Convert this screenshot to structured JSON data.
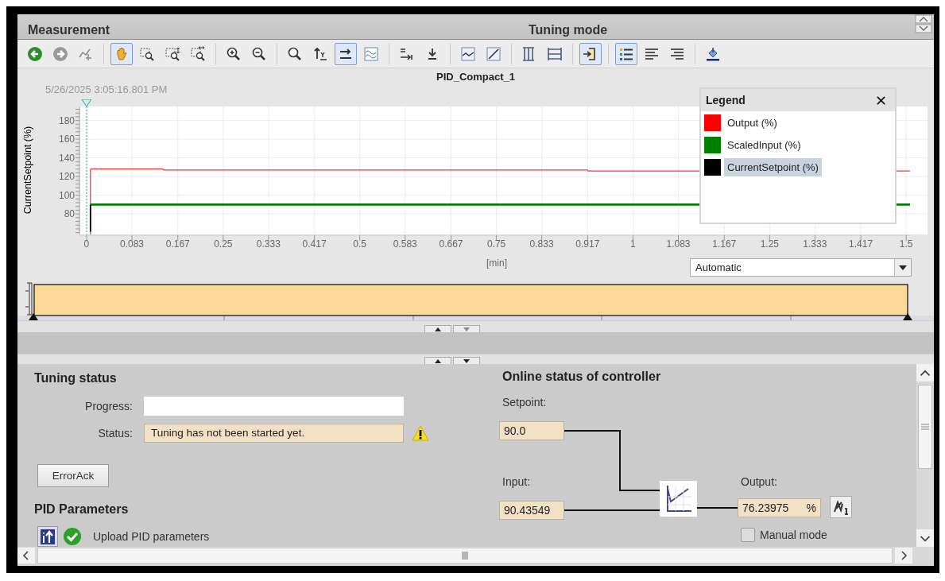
{
  "header": {
    "left": "Measurement",
    "right": "Tuning mode"
  },
  "toolbar_groups": [
    {
      "buttons": [
        {
          "kind": "back",
          "selected": false
        },
        {
          "kind": "forward",
          "selected": false
        },
        {
          "kind": "graph",
          "selected": false
        }
      ]
    },
    {
      "buttons": [
        {
          "kind": "hand",
          "selected": true
        },
        {
          "kind": "zoombox",
          "selected": false
        },
        {
          "kind": "zoomv",
          "selected": false
        },
        {
          "kind": "zoomh",
          "selected": false
        }
      ]
    },
    {
      "buttons": [
        {
          "kind": "zoomin",
          "selected": false
        },
        {
          "kind": "zoomout",
          "selected": false
        }
      ]
    },
    {
      "buttons": [
        {
          "kind": "zoomreset",
          "selected": false
        },
        {
          "kind": "yreset",
          "selected": false
        },
        {
          "kind": "xreset",
          "selected": true
        },
        {
          "kind": "wave",
          "selected": false
        }
      ]
    },
    {
      "buttons": [
        {
          "kind": "time",
          "selected": false
        },
        {
          "kind": "down",
          "selected": false
        }
      ]
    },
    {
      "buttons": [
        {
          "kind": "stepline",
          "selected": false
        },
        {
          "kind": "diagonal",
          "selected": false
        }
      ]
    },
    {
      "buttons": [
        {
          "kind": "columns",
          "selected": false
        },
        {
          "kind": "rows",
          "selected": false
        }
      ]
    },
    {
      "buttons": [
        {
          "kind": "measure",
          "selected": true
        }
      ]
    },
    {
      "buttons": [
        {
          "kind": "list",
          "selected": true
        },
        {
          "kind": "alignleft",
          "selected": false
        },
        {
          "kind": "alignright",
          "selected": false
        }
      ]
    },
    {
      "buttons": [
        {
          "kind": "paint",
          "selected": false
        }
      ]
    }
  ],
  "cursor_time": "5/26/2025  3:05:16.801 PM",
  "chart_data": {
    "type": "line",
    "title": "PID_Compact_1",
    "xlabel": "[min]",
    "ylabel": "CurrentSetpoint (%)",
    "x": [
      0.007,
      0.007,
      0.14,
      0.14,
      0.917,
      0.917,
      1.507
    ],
    "series": [
      {
        "name": "Output (%)",
        "color": "#ff0000",
        "values": [
          58,
          128,
          128,
          127,
          127,
          126,
          126
        ]
      },
      {
        "name": "ScaledInput (%)",
        "color": "#008000",
        "values": [
          null,
          90,
          90,
          90,
          90,
          90,
          90
        ]
      },
      {
        "name": "CurrentSetpoint (%)",
        "color": "#000000",
        "values": [
          61,
          90,
          null,
          null,
          null,
          null,
          null
        ]
      }
    ],
    "ref_lines": [
      {
        "axis": "x",
        "value": 0
      }
    ],
    "grid": true,
    "xlim": [
      -0.013,
      1.507
    ],
    "ylim": [
      58,
      195
    ],
    "xticks": [
      0,
      0.083,
      0.167,
      0.25,
      0.333,
      0.417,
      0.5,
      0.583,
      0.667,
      0.75,
      0.833,
      0.917,
      1,
      1.083,
      1.167,
      1.25,
      1.333,
      1.417,
      1.5
    ],
    "yticks": [
      80,
      100,
      120,
      140,
      160,
      180
    ]
  },
  "legend": {
    "title": "Legend",
    "close": "✕",
    "rows": [
      {
        "selected": false
      },
      {
        "selected": false
      },
      {
        "selected": true
      }
    ]
  },
  "time_range": {
    "value": "Automatic"
  },
  "tuning_status": {
    "title": "Tuning status",
    "progress": {
      "label": "Progress:",
      "level": 0
    },
    "status": {
      "label": "Status:",
      "value": "Tuning has not been started yet.",
      "warning": true
    }
  },
  "error_ack_button": "ErrorAck",
  "pid_parameters": {
    "title": "PID Parameters",
    "upload_label": "Upload PID parameters",
    "upload_ok": true
  },
  "online_status": {
    "title": "Online status of controller",
    "setpoint": {
      "label": "Setpoint:",
      "value": "90.0"
    },
    "input": {
      "label": "Input:",
      "value": "90.43549"
    },
    "output": {
      "label": "Output:",
      "value": "76.23975",
      "unit": "%"
    },
    "manual_mode": {
      "label": "Manual mode",
      "checked": false
    }
  }
}
